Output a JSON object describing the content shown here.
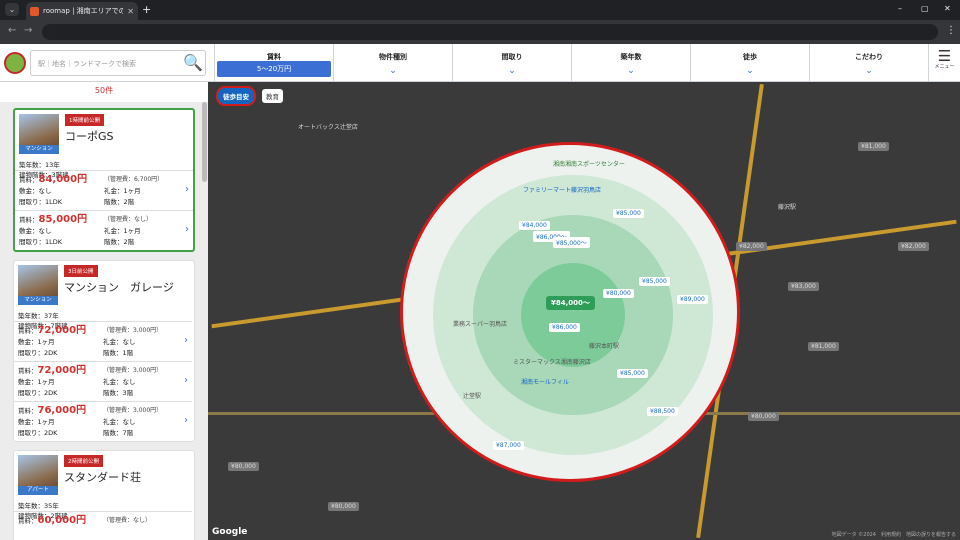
{
  "browser": {
    "tab_title": "roomap | 湘南エリアでのお部屋探",
    "tab_close": "✕",
    "new_tab": "+",
    "tab_list": "⌄",
    "window_controls": [
      "–",
      "▢",
      "✕"
    ],
    "nav": [
      "←",
      "→",
      "C"
    ],
    "menu": "⋮"
  },
  "header": {
    "search_placeholder": "駅｜地名｜ランドマークで検索",
    "search_icon": "🔍",
    "filters": [
      {
        "label": "賃料",
        "value": "5～20万円"
      },
      {
        "label": "物件種別",
        "caret": "⌄"
      },
      {
        "label": "間取り",
        "caret": "⌄"
      },
      {
        "label": "築年数",
        "caret": "⌄"
      },
      {
        "label": "徒歩",
        "caret": "⌄"
      },
      {
        "label": "こだわり",
        "caret": "⌄"
      }
    ],
    "menu_icon": "☰",
    "menu_label": "メニュー"
  },
  "list": {
    "count": "50件",
    "cards": [
      {
        "badge": "1時間前公開",
        "type": "マンション",
        "name": "コーポGS",
        "age_label": "築年数：",
        "age": "13年",
        "floors_label": "建物階数：",
        "floors": "3階建",
        "units": [
          {
            "rent_label": "賃料：",
            "rent": "84,000円",
            "fee": "（管理費：6,700円）",
            "deposit": "敷金：なし",
            "key": "礼金：1ヶ月",
            "layout": "間取り：1LDK",
            "floor": "階数：2階"
          },
          {
            "rent_label": "賃料：",
            "rent": "85,000円",
            "fee": "（管理費：なし）",
            "deposit": "敷金：なし",
            "key": "礼金：1ヶ月",
            "layout": "間取り：1LDK",
            "floor": "階数：2階"
          }
        ]
      },
      {
        "badge": "3日前公開",
        "type": "マンション",
        "name": "マンション　ガレージ",
        "age_label": "築年数：",
        "age": "37年",
        "floors_label": "建物階数：",
        "floors": "7階建",
        "units": [
          {
            "rent_label": "賃料：",
            "rent": "72,000円",
            "fee": "（管理費：3,000円）",
            "deposit": "敷金：1ヶ月",
            "key": "礼金：なし",
            "layout": "間取り：2DK",
            "floor": "階数：1階"
          },
          {
            "rent_label": "賃料：",
            "rent": "72,000円",
            "fee": "（管理費：3,000円）",
            "deposit": "敷金：1ヶ月",
            "key": "礼金：なし",
            "layout": "間取り：2DK",
            "floor": "階数：3階"
          },
          {
            "rent_label": "賃料：",
            "rent": "76,000円",
            "fee": "（管理費：3,000円）",
            "deposit": "敷金：1ヶ月",
            "key": "礼金：なし",
            "layout": "間取り：2DK",
            "floor": "階数：7階"
          }
        ]
      },
      {
        "badge": "2時間前公開",
        "type": "アパート",
        "name": "スタンダード荘",
        "age_label": "築年数：",
        "age": "35年",
        "floors_label": "建物階数：",
        "floors": "2階建",
        "units": [
          {
            "rent_label": "賃料：",
            "rent": "60,000円",
            "fee": "（管理費：なし）",
            "deposit": "",
            "key": "",
            "layout": "",
            "floor": ""
          }
        ]
      }
    ]
  },
  "map": {
    "walk_tag": "徒歩目安",
    "edu_tag": "教育",
    "center_price": "¥84,000～",
    "inner_prices": [
      "¥84,000",
      "¥86,000～",
      "¥85,000～",
      "¥85,000",
      "¥85,000",
      "¥80,000",
      "¥89,000",
      "¥86,000",
      "¥85,000",
      "¥88,500",
      "¥87,000"
    ],
    "outer_prices": [
      "¥80,000",
      "¥81,000",
      "¥82,000",
      "¥83,000",
      "¥82,000",
      "¥81,000",
      "¥80,000",
      "¥80,000"
    ],
    "labels": [
      "湘南湘南スポーツセンター",
      "ファミリーマート藤沢羽鳥店",
      "湘南モールフィル",
      "藤沢本町駅",
      "藤沢駅",
      "辻堂駅",
      "ミスターマックス湘南藤沢店",
      "業務スーパー羽鳥店",
      "オートバックス辻堂店"
    ],
    "google": "Google",
    "footer": "地図データ ©2024　利用規約　地図の誤りを報告する"
  }
}
